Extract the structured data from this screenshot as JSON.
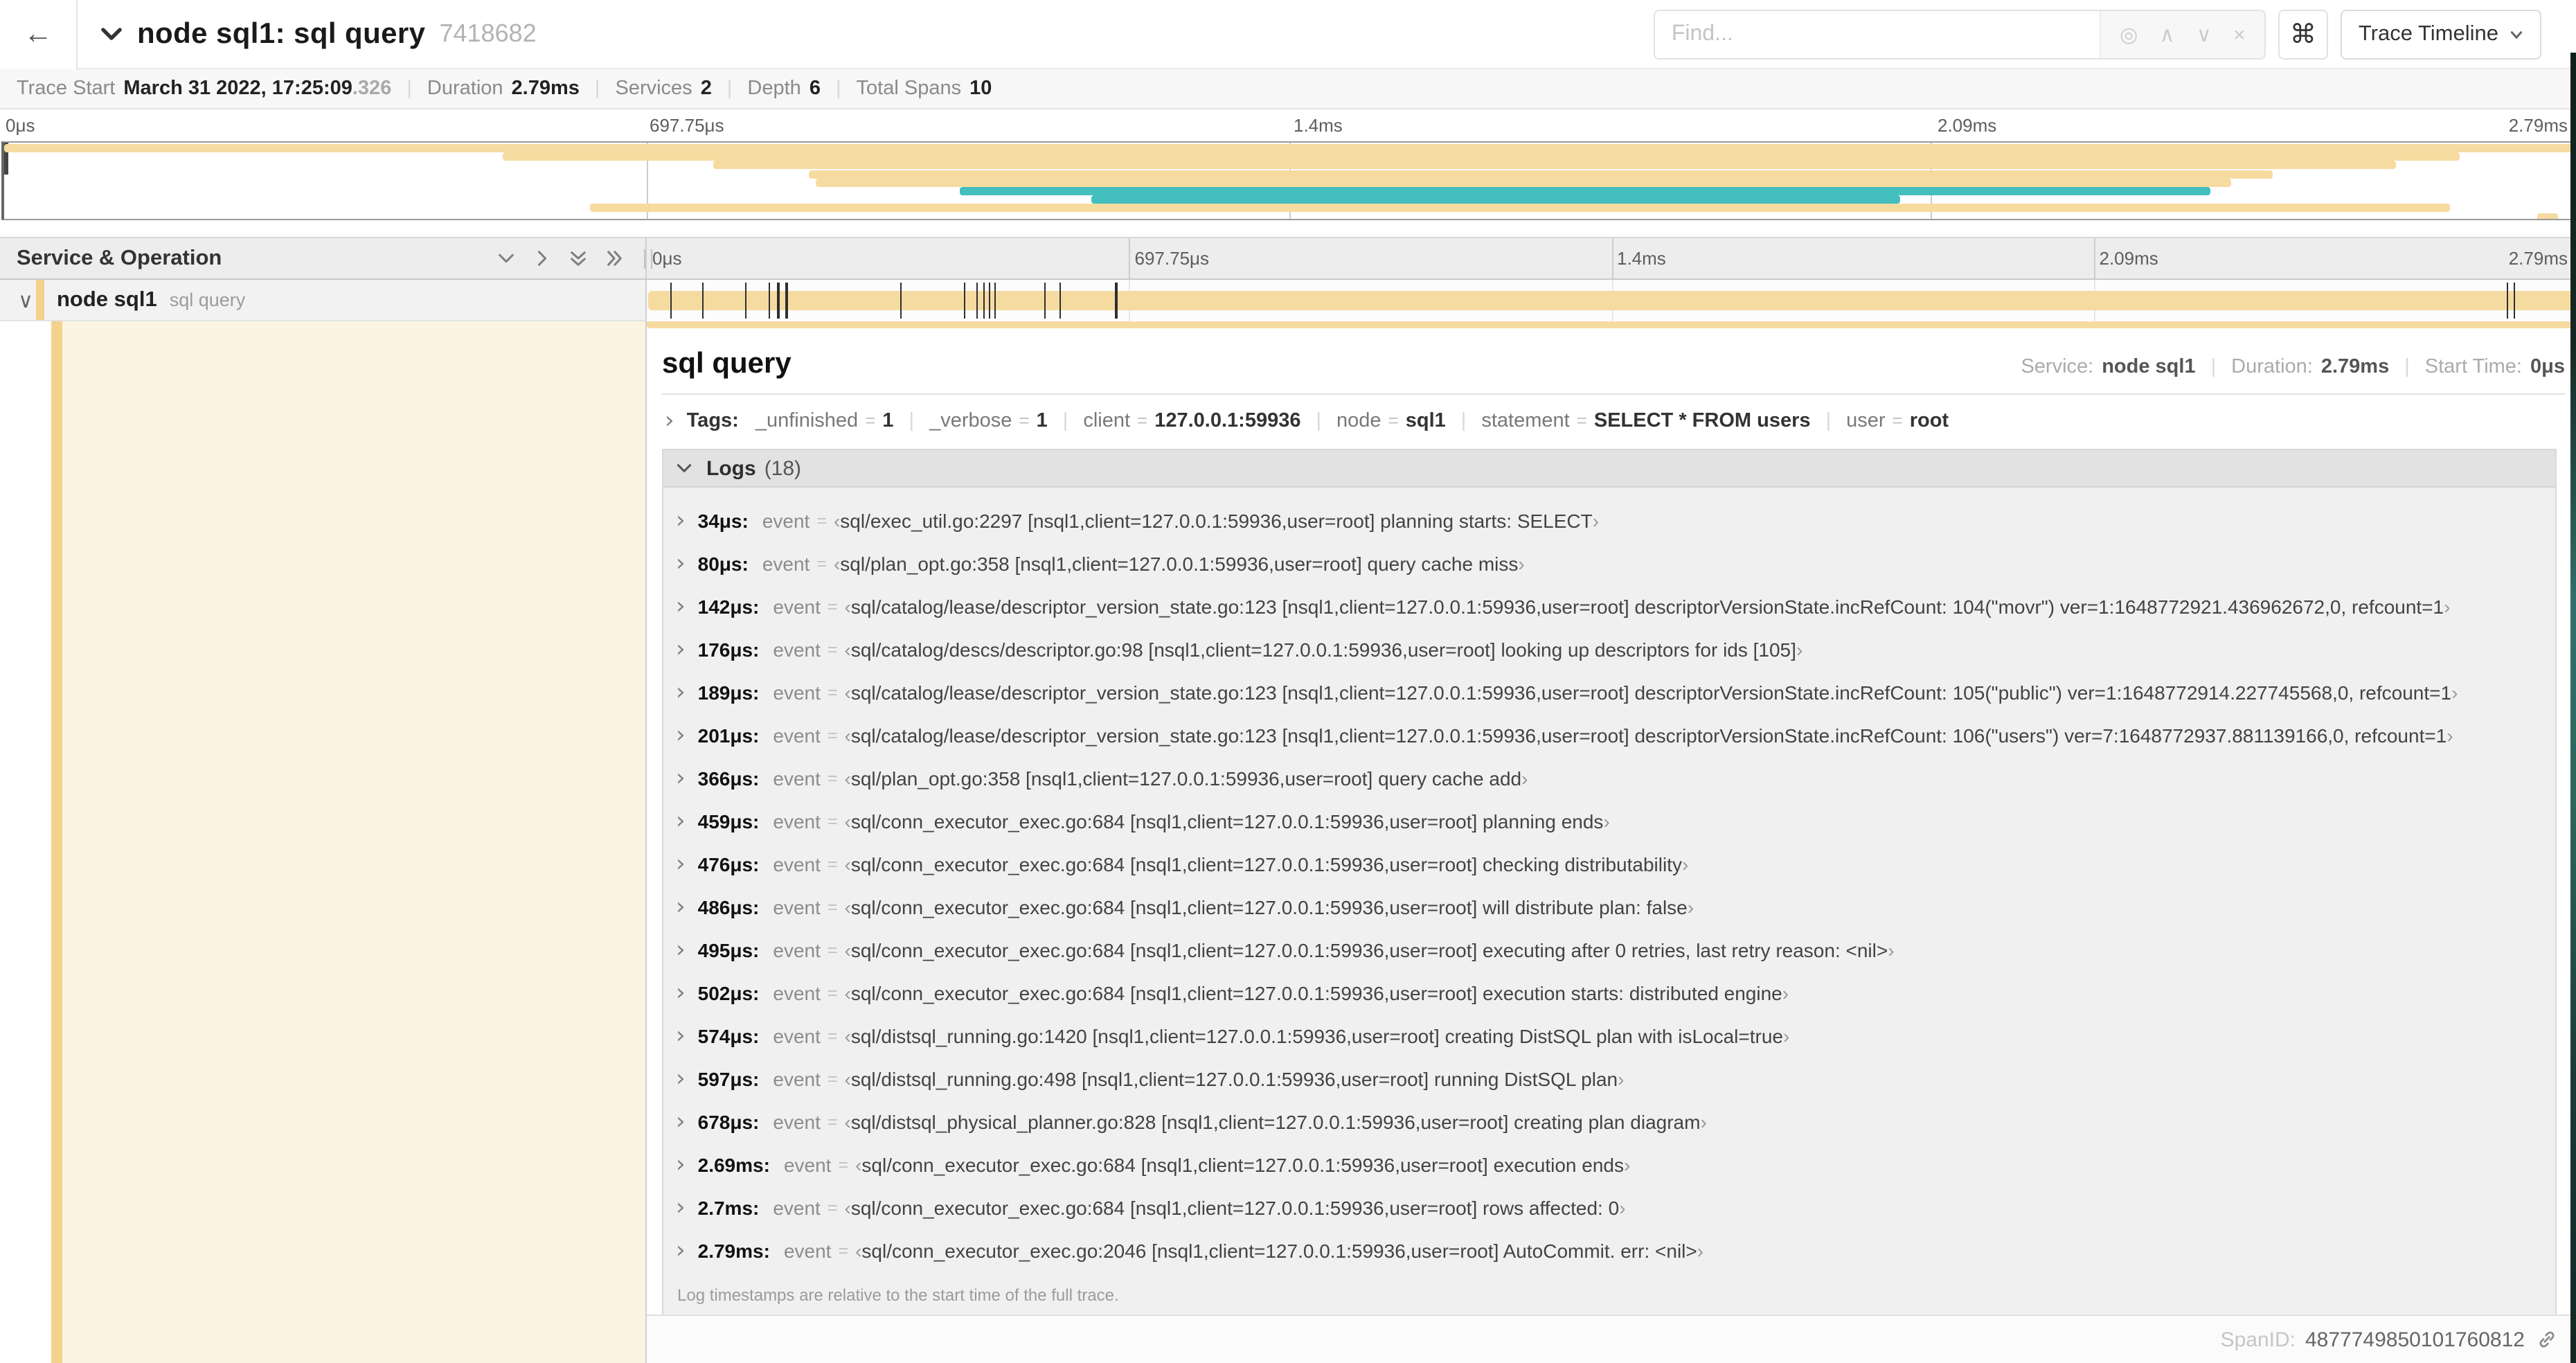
{
  "header": {
    "title": "node sql1: sql query",
    "trace_id": "7418682",
    "find_placeholder": "Find...",
    "shortcut_label": "⌘",
    "view_selector_label": "Trace Timeline"
  },
  "summary": {
    "items": [
      {
        "label": "Trace Start",
        "value": "March 31 2022, 17:25:09",
        "suffix": ".326"
      },
      {
        "label": "Duration",
        "value": "2.79ms"
      },
      {
        "label": "Services",
        "value": "2"
      },
      {
        "label": "Depth",
        "value": "6"
      },
      {
        "label": "Total Spans",
        "value": "10"
      }
    ]
  },
  "ruler": {
    "ticks": [
      "0μs",
      "697.75μs",
      "1.4ms",
      "2.09ms",
      "2.79ms"
    ],
    "gridline_percents": [
      25,
      50,
      75
    ]
  },
  "minimap": {
    "bars": [
      {
        "color": "beige",
        "left": 0.0,
        "width": 100.0
      },
      {
        "color": "beige",
        "left": 19.4,
        "width": 76.2
      },
      {
        "color": "beige",
        "left": 27.6,
        "width": 65.5
      },
      {
        "color": "beige",
        "left": 31.3,
        "width": 57.0
      },
      {
        "color": "beige",
        "left": 31.6,
        "width": 55.1
      },
      {
        "color": "teal",
        "left": 37.2,
        "width": 48.7
      },
      {
        "color": "teal",
        "left": 42.3,
        "width": 31.5
      },
      {
        "color": "beige",
        "left": 22.8,
        "width": 72.4
      },
      {
        "color": "beige",
        "left": 98.6,
        "width": 0.8
      }
    ]
  },
  "timeline_header": {
    "title": "Service & Operation"
  },
  "span": {
    "service": "node sql1",
    "operation": "sql query",
    "bar": {
      "left": 0.1,
      "width": 99.8
    },
    "tick_percents": [
      1.22,
      2.87,
      5.09,
      6.31,
      6.77,
      7.2,
      13.12,
      16.45,
      17.06,
      17.42,
      17.74,
      17.99,
      20.57,
      21.4,
      24.3,
      96.42,
      96.77,
      99.8
    ]
  },
  "detail": {
    "title": "sql query",
    "meta": [
      {
        "label": "Service:",
        "value": "node sql1"
      },
      {
        "label": "Duration:",
        "value": "2.79ms"
      },
      {
        "label": "Start Time:",
        "value": "0μs"
      }
    ],
    "tags_label": "Tags:",
    "tags": [
      {
        "key": "_unfinished",
        "value": "1"
      },
      {
        "key": "_verbose",
        "value": "1"
      },
      {
        "key": "client",
        "value": "127.0.0.1:59936"
      },
      {
        "key": "node",
        "value": "sql1"
      },
      {
        "key": "statement",
        "value": "SELECT * FROM users"
      },
      {
        "key": "user",
        "value": "root"
      }
    ],
    "logs_label": "Logs",
    "logs_count": "(18)",
    "logs": [
      {
        "time": "34μs:",
        "key": "event",
        "value": "sql/exec_util.go:2297 [nsql1,client=127.0.0.1:59936,user=root] planning starts: SELECT"
      },
      {
        "time": "80μs:",
        "key": "event",
        "value": "sql/plan_opt.go:358 [nsql1,client=127.0.0.1:59936,user=root] query cache miss"
      },
      {
        "time": "142μs:",
        "key": "event",
        "value": "sql/catalog/lease/descriptor_version_state.go:123 [nsql1,client=127.0.0.1:59936,user=root] descriptorVersionState.incRefCount: 104(\"movr\") ver=1:1648772921.436962672,0, refcount=1"
      },
      {
        "time": "176μs:",
        "key": "event",
        "value": "sql/catalog/descs/descriptor.go:98 [nsql1,client=127.0.0.1:59936,user=root] looking up descriptors for ids [105]"
      },
      {
        "time": "189μs:",
        "key": "event",
        "value": "sql/catalog/lease/descriptor_version_state.go:123 [nsql1,client=127.0.0.1:59936,user=root] descriptorVersionState.incRefCount: 105(\"public\") ver=1:1648772914.227745568,0, refcount=1"
      },
      {
        "time": "201μs:",
        "key": "event",
        "value": "sql/catalog/lease/descriptor_version_state.go:123 [nsql1,client=127.0.0.1:59936,user=root] descriptorVersionState.incRefCount: 106(\"users\") ver=7:1648772937.881139166,0, refcount=1"
      },
      {
        "time": "366μs:",
        "key": "event",
        "value": "sql/plan_opt.go:358 [nsql1,client=127.0.0.1:59936,user=root] query cache add"
      },
      {
        "time": "459μs:",
        "key": "event",
        "value": "sql/conn_executor_exec.go:684 [nsql1,client=127.0.0.1:59936,user=root] planning ends"
      },
      {
        "time": "476μs:",
        "key": "event",
        "value": "sql/conn_executor_exec.go:684 [nsql1,client=127.0.0.1:59936,user=root] checking distributability"
      },
      {
        "time": "486μs:",
        "key": "event",
        "value": "sql/conn_executor_exec.go:684 [nsql1,client=127.0.0.1:59936,user=root] will distribute plan: false"
      },
      {
        "time": "495μs:",
        "key": "event",
        "value": "sql/conn_executor_exec.go:684 [nsql1,client=127.0.0.1:59936,user=root] executing after 0 retries, last retry reason: <nil>"
      },
      {
        "time": "502μs:",
        "key": "event",
        "value": "sql/conn_executor_exec.go:684 [nsql1,client=127.0.0.1:59936,user=root] execution starts: distributed engine"
      },
      {
        "time": "574μs:",
        "key": "event",
        "value": "sql/distsql_running.go:1420 [nsql1,client=127.0.0.1:59936,user=root] creating DistSQL plan with isLocal=true"
      },
      {
        "time": "597μs:",
        "key": "event",
        "value": "sql/distsql_running.go:498 [nsql1,client=127.0.0.1:59936,user=root] running DistSQL plan"
      },
      {
        "time": "678μs:",
        "key": "event",
        "value": "sql/distsql_physical_planner.go:828 [nsql1,client=127.0.0.1:59936,user=root] creating plan diagram"
      },
      {
        "time": "2.69ms:",
        "key": "event",
        "value": "sql/conn_executor_exec.go:684 [nsql1,client=127.0.0.1:59936,user=root] execution ends"
      },
      {
        "time": "2.7ms:",
        "key": "event",
        "value": "sql/conn_executor_exec.go:684 [nsql1,client=127.0.0.1:59936,user=root] rows affected: 0"
      },
      {
        "time": "2.79ms:",
        "key": "event",
        "value": "sql/conn_executor_exec.go:2046 [nsql1,client=127.0.0.1:59936,user=root] AutoCommit. err: <nil>"
      }
    ],
    "logs_note": "Log timestamps are relative to the start time of the full trace.",
    "spanid_label": "SpanID:",
    "spanid_value": "4877749850101760812"
  },
  "colors": {
    "beige": "#f6dba1",
    "teal": "#43bfbf",
    "accent_strip": "#f3d28e",
    "detail_tint": "#fcf4e2"
  }
}
